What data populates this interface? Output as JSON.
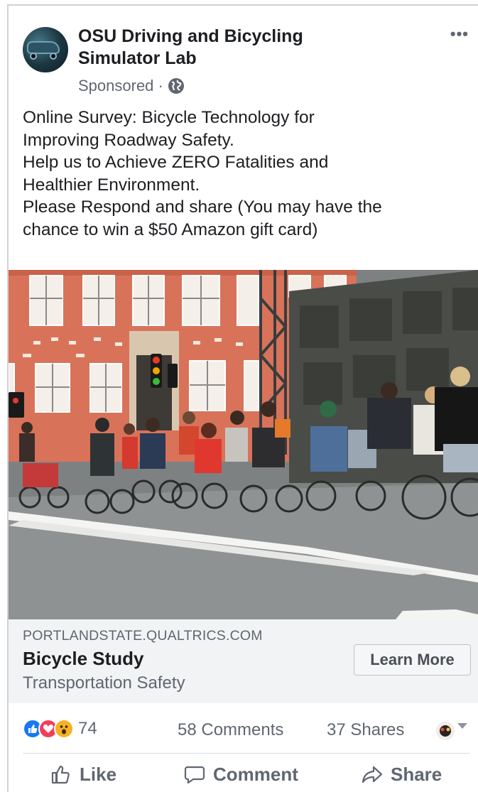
{
  "post": {
    "page_name": "OSU Driving and Bicycling Simulator Lab",
    "page_name_line1": "OSU Driving and Bicycling",
    "page_name_line2": "Simulator Lab",
    "sponsored_label": "Sponsored · ",
    "more_icon": "more-icon",
    "text_lines": [
      "Online Survey: Bicycle Technology for",
      "Improving Roadway Safety.",
      "Help us to Achieve ZERO Fatalities and",
      "Healthier Environment.",
      "Please Respond and share (You may have the",
      "chance to win a $50 Amazon gift card)"
    ]
  },
  "link": {
    "domain": "PORTLANDSTATE.QUALTRICS.COM",
    "title": "Bicycle Study",
    "description": "Transportation Safety",
    "cta_label": "Learn More"
  },
  "stats": {
    "reaction_icons": [
      "like-reaction-icon",
      "love-reaction-icon",
      "wow-reaction-icon"
    ],
    "reaction_count": "74",
    "comments": "58 Comments",
    "shares": "37 Shares"
  },
  "actions": {
    "like": "Like",
    "comment": "Comment",
    "share": "Share"
  },
  "colors": {
    "brand_blue": "#1877f2",
    "love_red": "#f33e58",
    "wow_yellow": "#f7b125",
    "secondary_text": "#606770",
    "link_box_bg": "#f2f3f5"
  }
}
